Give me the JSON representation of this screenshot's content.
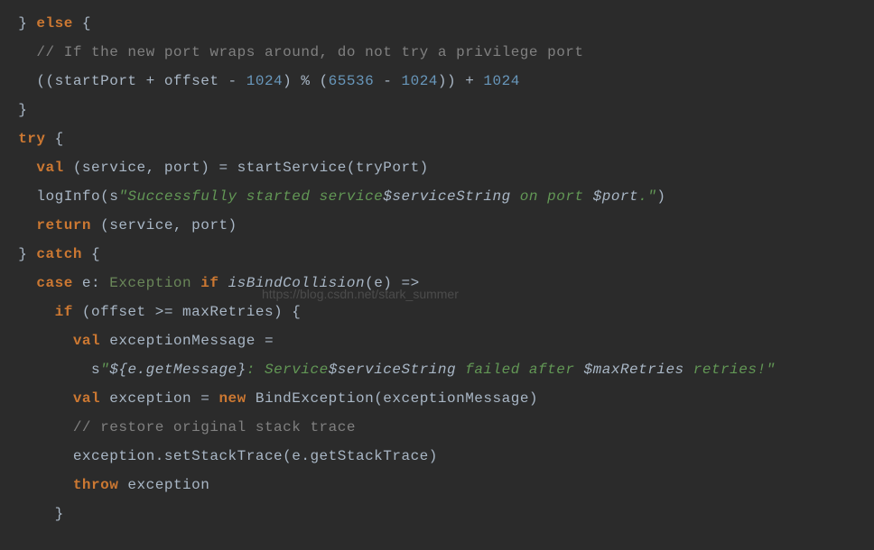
{
  "code": {
    "l1": {
      "p1": "  } ",
      "kw1": "else",
      "p2": " {"
    },
    "l2": {
      "cmt": "    // If the new port wraps around, do not try a privilege port"
    },
    "l3": {
      "p1": "    ((startPort + offset - ",
      "n1": "1024",
      "p2": ") % (",
      "n2": "65536",
      "p3": " - ",
      "n3": "1024",
      "p4": ")) + ",
      "n4": "1024"
    },
    "l4": {
      "p1": "  }"
    },
    "l5": {
      "kw1": "  try",
      "p1": " {"
    },
    "l6": {
      "p1": "    ",
      "kw1": "val",
      "p2": " (service, port) = startService(tryPort)"
    },
    "l7": {
      "p1": "    logInfo(s",
      "s1": "\"Successfully started service",
      "i1": "$serviceString",
      "s2": " on port ",
      "i2": "$port",
      "s3": ".\"",
      "p2": ")"
    },
    "l8": {
      "p1": "    ",
      "kw1": "return",
      "p2": " (service, port)"
    },
    "l9": {
      "p1": "  } ",
      "kw1": "catch",
      "p2": " {"
    },
    "l10": {
      "p1": "    ",
      "kw1": "case",
      "p2": " e: ",
      "cls": "Exception",
      "p3": " ",
      "kw2": "if",
      "p4": " ",
      "fn": "isBindCollision",
      "p5": "(e) =>"
    },
    "l11": {
      "p1": "      ",
      "kw1": "if",
      "p2": " (offset >= maxRetries) {"
    },
    "l12": {
      "p1": "        ",
      "kw1": "val",
      "p2": " exceptionMessage ="
    },
    "l13": {
      "p1": "          s",
      "s1": "\"",
      "i1": "${e.getMessage}",
      "s2": ": Service",
      "i2": "$serviceString",
      "s3": " failed after ",
      "i3": "$maxRetries",
      "s4": " retries!\""
    },
    "l14": {
      "p1": "        ",
      "kw1": "val",
      "p2": " exception = ",
      "kw2": "new",
      "p3": " BindException(exceptionMessage)"
    },
    "l15": {
      "cmt": "        // restore original stack trace"
    },
    "l16": {
      "p1": "        exception.setStackTrace(e.getStackTrace)"
    },
    "l17": {
      "p1": "        ",
      "kw1": "throw",
      "p2": " exception"
    },
    "l18": {
      "p1": "      }"
    }
  },
  "watermark": "https://blog.csdn.net/stark_summer"
}
